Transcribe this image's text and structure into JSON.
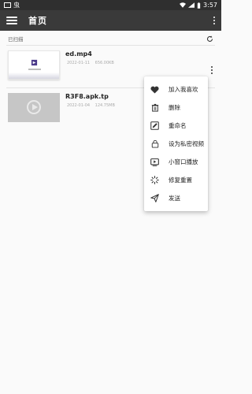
{
  "status_bar": {
    "time": "3:57",
    "left_glyph": "虫"
  },
  "app_bar": {
    "title": "首页"
  },
  "section": {
    "label": "已扫描"
  },
  "files": [
    {
      "name": "ed.mp4",
      "date": "2022-01-11",
      "size": "656.00KB",
      "thumb": "video-preview"
    },
    {
      "name": "R3F8.apk.tp",
      "date": "2022-01-04",
      "size": "124.75MB",
      "thumb": "video-placeholder"
    }
  ],
  "menu": [
    {
      "label": "加入我喜欢",
      "icon": "heart-icon"
    },
    {
      "label": "删除",
      "icon": "trash-icon"
    },
    {
      "label": "重命名",
      "icon": "edit-icon"
    },
    {
      "label": "设为私密视频",
      "icon": "lock-icon"
    },
    {
      "label": "小窗口播放",
      "icon": "pip-icon"
    },
    {
      "label": "修复重置",
      "icon": "repair-icon"
    },
    {
      "label": "发送",
      "icon": "send-icon"
    }
  ],
  "colors": {
    "app_bar": "#3a3a3a",
    "status_bar": "#2f2f2f",
    "background": "#fafafa"
  }
}
